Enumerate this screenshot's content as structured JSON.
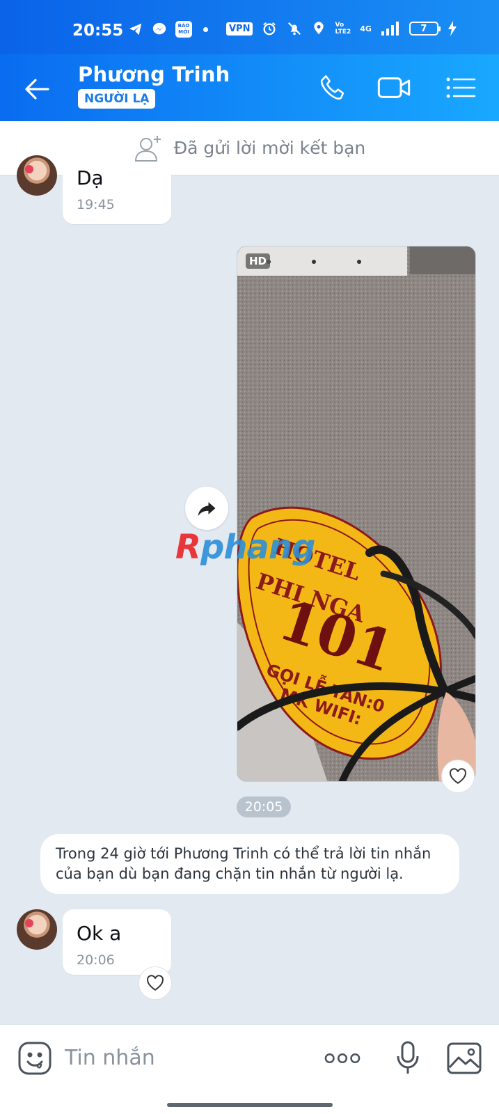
{
  "status_bar": {
    "time": "20:55",
    "news_icon_text": "BÁO\nMỚI",
    "vpn": "VPN",
    "volte": "Vo\nLTE2",
    "network": "4G",
    "battery": "7"
  },
  "header": {
    "contact_name": "Phương Trinh",
    "stranger_badge": "NGƯỜI LẠ"
  },
  "friend_banner": {
    "text": "Đã gửi lời mời kết bạn"
  },
  "messages": [
    {
      "text": "Dạ",
      "time": "19:45"
    },
    {
      "text": "Ok a",
      "time": "20:06"
    }
  ],
  "image_message": {
    "badge": "HD",
    "time": "20:05",
    "photo_text": {
      "hotel": "HOTEL",
      "name": "PHI NGA",
      "room": "101",
      "line1": "GỌI LỄ TÂN:0",
      "line2": "MK WIFI:"
    }
  },
  "system_note": {
    "text": "Trong 24 giờ tới Phương Trinh có thể trả lời tin nhắn của bạn dù bạn đang chặn tin nhắn từ người lạ."
  },
  "watermark": {
    "r": "R",
    "rest": "phang"
  },
  "input": {
    "placeholder": "Tin nhắn"
  },
  "colors": {
    "header_start": "#0a6cf0",
    "header_end": "#19a8ff",
    "chat_bg": "#e2e9f1"
  }
}
